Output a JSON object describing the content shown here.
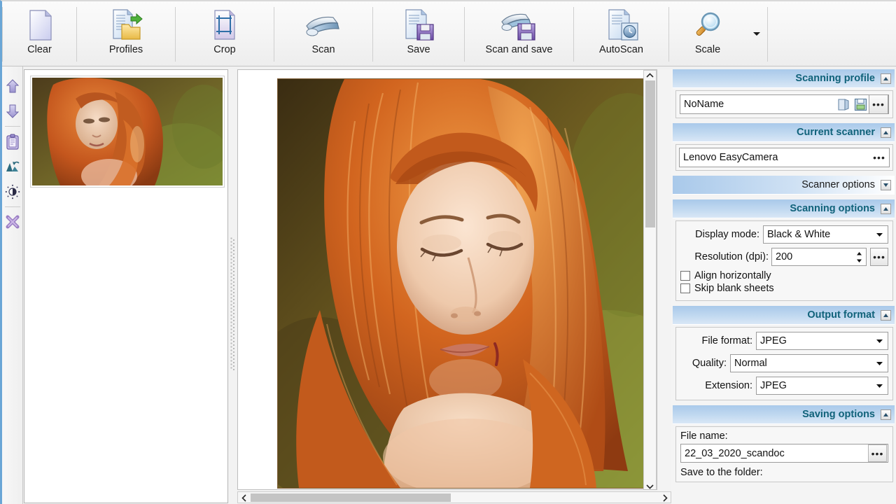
{
  "toolbar": {
    "buttons": [
      {
        "label": "Clear",
        "icon": "blank-page-icon"
      },
      {
        "label": "Profiles",
        "icon": "page-folder-icon"
      },
      {
        "label": "Crop",
        "icon": "crop-page-icon"
      },
      {
        "label": "Scan",
        "icon": "scanner-icon"
      },
      {
        "label": "Save",
        "icon": "page-floppy-icon"
      },
      {
        "label": "Scan and save",
        "icon": "scanner-floppy-icon"
      },
      {
        "label": "AutoScan",
        "icon": "page-clock-icon"
      },
      {
        "label": "Scale",
        "icon": "magnifier-icon"
      }
    ],
    "overflow_icon": "chevron-down-icon"
  },
  "rail": {
    "items": [
      {
        "name": "move-up",
        "icon": "arrow-up-icon"
      },
      {
        "name": "move-down",
        "icon": "arrow-down-icon"
      },
      {
        "name": "clipboard",
        "icon": "clipboard-icon"
      },
      {
        "name": "rotate",
        "icon": "rotate-icon"
      },
      {
        "name": "brightness",
        "icon": "brightness-icon"
      },
      {
        "name": "delete",
        "icon": "x-cross-icon"
      }
    ]
  },
  "viewer": {
    "vertical_scrollbar": {
      "up_icon": "chevron-up-icon",
      "down_icon": "chevron-down-icon"
    },
    "horizontal_scrollbar": {
      "left_icon": "chevron-left-icon",
      "right_icon": "chevron-right-icon"
    }
  },
  "sidebar": {
    "scanning_profile": {
      "title": "Scanning profile",
      "collapse_icon": "collapse-up-icon",
      "value": "NoName",
      "open_icon": "open-folder-icon",
      "save_icon": "floppy-save-icon",
      "more_label": "•••"
    },
    "current_scanner": {
      "title": "Current scanner",
      "collapse_icon": "collapse-up-icon",
      "value": "Lenovo EasyCamera",
      "more_label": "•••"
    },
    "scanner_options": {
      "title": "Scanner options",
      "expand_icon": "expand-down-icon"
    },
    "scanning_options": {
      "title": "Scanning options",
      "collapse_icon": "collapse-up-icon",
      "display_mode_label": "Display mode:",
      "display_mode_value": "Black & White",
      "resolution_label": "Resolution (dpi):",
      "resolution_value": "200",
      "resolution_more_label": "•••",
      "align_horizontally_label": "Align horizontally",
      "align_horizontally_checked": false,
      "skip_blank_sheets_label": "Skip blank sheets",
      "skip_blank_sheets_checked": false
    },
    "output_format": {
      "title": "Output format",
      "collapse_icon": "collapse-up-icon",
      "file_format_label": "File format:",
      "file_format_value": "JPEG",
      "quality_label": "Quality:",
      "quality_value": "Normal",
      "extension_label": "Extension:",
      "extension_value": "JPEG"
    },
    "saving_options": {
      "title": "Saving options",
      "collapse_icon": "collapse-up-icon",
      "file_name_label": "File name:",
      "file_name_value": "22_03_2020_scandoc",
      "file_name_more_label": "•••",
      "folder_label": "Save to the folder:"
    }
  },
  "colors": {
    "header_blue": "#a9c9ea",
    "title_teal": "#10627a",
    "window_border": "#6aa6d6",
    "scrollbar_thumb": "#c4c4c4"
  }
}
